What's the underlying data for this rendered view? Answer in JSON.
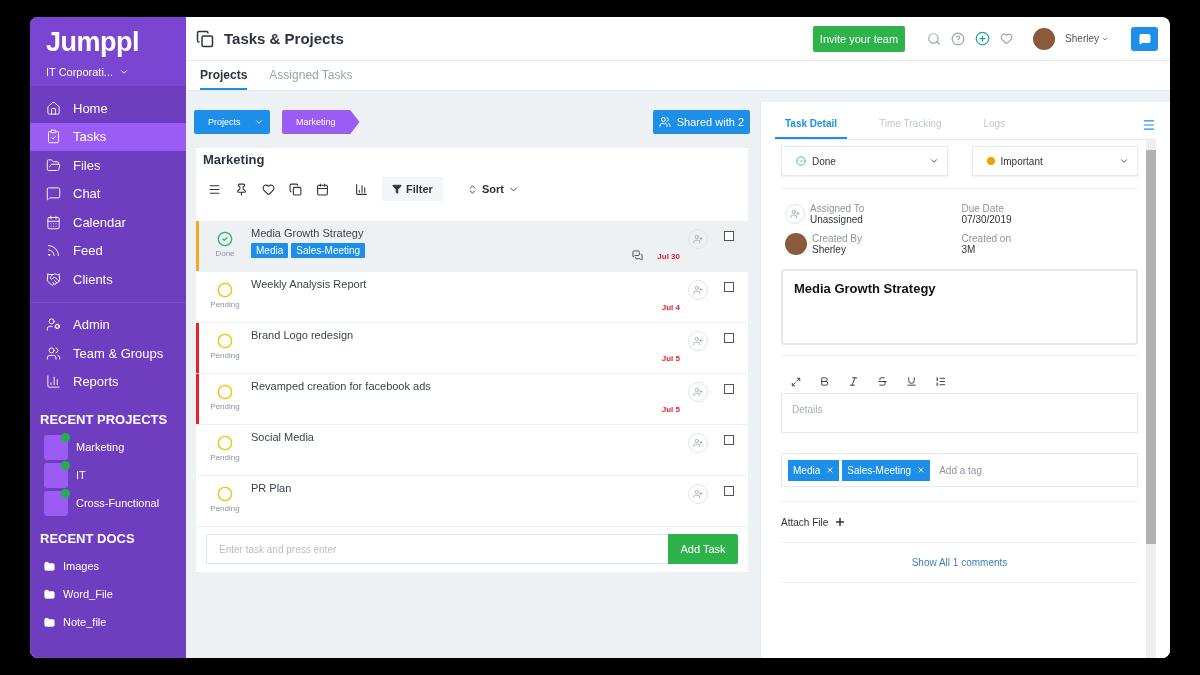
{
  "sidebar": {
    "logo": "Jumppl",
    "company": "IT Corporati...",
    "nav": [
      {
        "label": "Home",
        "selected": false
      },
      {
        "label": "Tasks",
        "selected": true
      },
      {
        "label": "Files",
        "selected": false
      },
      {
        "label": "Chat",
        "selected": false
      },
      {
        "label": "Calendar",
        "selected": false
      },
      {
        "label": "Feed",
        "selected": false
      },
      {
        "label": "Clients",
        "selected": false
      }
    ],
    "nav2": [
      {
        "label": "Admin",
        "selected": false
      },
      {
        "label": "Team & Groups",
        "selected": false
      },
      {
        "label": "Reports",
        "selected": false
      }
    ],
    "recent_projects_title": "RECENT PROJECTS",
    "recent_projects": [
      {
        "name": "Marketing",
        "color": "#22b04b"
      },
      {
        "name": "IT",
        "color": "#22b04b"
      },
      {
        "name": "Cross-Functional",
        "color": "#22b04b"
      }
    ],
    "recent_docs_title": "RECENT DOCS",
    "recent_docs": [
      "Images",
      "Word_File",
      "Note_file"
    ]
  },
  "header": {
    "title": "Tasks & Projects",
    "invite": "Invite your team",
    "user": "Sherley"
  },
  "tabs": [
    {
      "label": "Projects",
      "selected": true
    },
    {
      "label": "Assigned Tasks",
      "selected": false
    }
  ],
  "breadcrumb": {
    "root": "Projects",
    "current": "Marketing",
    "shared": "Shared with 2"
  },
  "list": {
    "title": "Marketing",
    "filter": "Filter",
    "sort": "Sort",
    "tasks": [
      {
        "name": "Media Growth Strategy",
        "kind": "done",
        "status_label": "Done",
        "selected": true,
        "checked": false,
        "color": "#f5a623",
        "tags": [
          "Media",
          "Sales-Meeting"
        ],
        "comments": true,
        "date": "Jul 30"
      },
      {
        "name": "Weekly Analysis Report",
        "kind": "pending",
        "status_label": "Pending",
        "selected": false,
        "checked": false,
        "comments": false,
        "date": "Jul 4"
      },
      {
        "name": "Brand Logo redesign",
        "kind": "pending",
        "status_label": "Pending",
        "selected": false,
        "checked": false,
        "color": "#e8202a",
        "comments": false,
        "date": "Jul 5"
      },
      {
        "name": "Revamped creation for facebook ads",
        "kind": "pending",
        "status_label": "Pending",
        "selected": false,
        "checked": false,
        "color": "#e8202a",
        "comments": false,
        "date": "Jul 5"
      },
      {
        "name": "Social Media",
        "kind": "pending",
        "status_label": "Pending",
        "selected": false,
        "checked": false,
        "comments": false
      },
      {
        "name": "PR Plan",
        "kind": "pending",
        "status_label": "Pending",
        "selected": false,
        "checked": false,
        "comments": false
      }
    ],
    "new_task": {
      "placeholder": "Enter task and press enter",
      "button": "Add Task"
    }
  },
  "detail": {
    "tabs": [
      {
        "label": "Task Detail",
        "selected": true
      },
      {
        "label": "Time Tracking",
        "selected": false
      },
      {
        "label": "Logs",
        "selected": false
      }
    ],
    "status": "Done",
    "priority": {
      "label": "Important",
      "color": "#f5a000"
    },
    "meta": [
      {
        "label": "Assigned To",
        "value": "Unassigned",
        "kind": "assignee"
      },
      {
        "label": "Due Date",
        "value": "07/30/2019",
        "kind": "plain"
      },
      {
        "label": "Created By",
        "value": "Sherley",
        "kind": "avatar"
      },
      {
        "label": "Created on",
        "value": "3M",
        "kind": "plain"
      }
    ],
    "title": "Media Growth Strategy",
    "details_placeholder": "Details",
    "tags": [
      "Media",
      "Sales-Meeting"
    ],
    "tag_placeholder": "Add a tag",
    "attach": "Attach File",
    "comments_link": "Show All 1 comments"
  }
}
